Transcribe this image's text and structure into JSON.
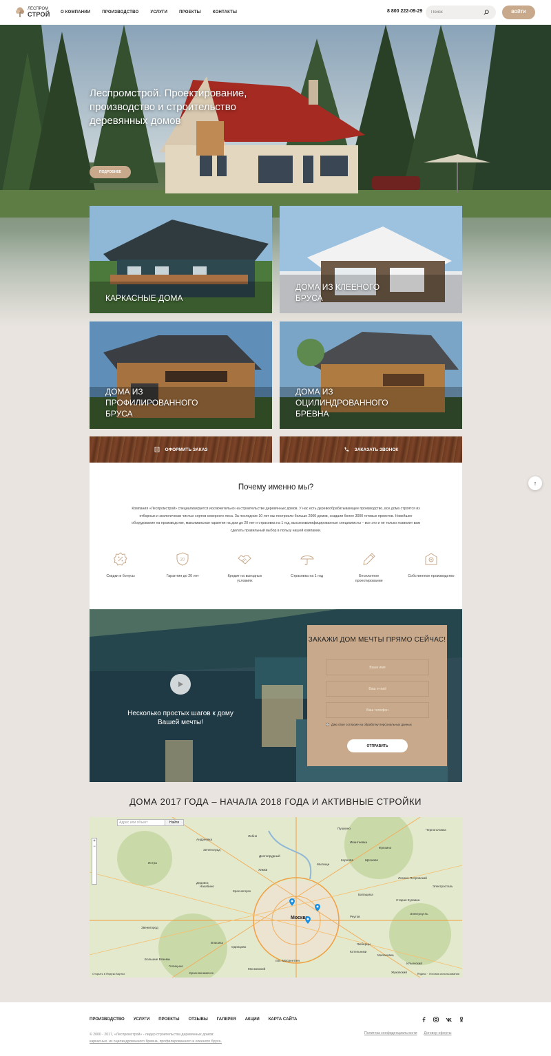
{
  "header": {
    "logo_top": "ЛЕСПРОМ",
    "logo_bottom": "СТРОЙ",
    "nav": [
      "О КОМПАНИИ",
      "ПРОИЗВОДСТВО",
      "УСЛУГИ",
      "ПРОЕКТЫ",
      "КОНТАКТЫ"
    ],
    "phone": "8 800 222-09-29",
    "search_placeholder": "Поиск",
    "login_label": "ВОЙТИ"
  },
  "hero": {
    "title": "Леспромстрой. Проектирование, производство и строительство деревянных домов",
    "button": "ПОДРОБНЕЕ"
  },
  "cards": [
    {
      "title": "КАРКАСНЫЕ ДОМА"
    },
    {
      "title": "ДОМА ИЗ КЛЕЕНОГО БРУСА"
    },
    {
      "title": "ДОМА ИЗ ПРОФИЛИРОВАННОГО БРУСА"
    },
    {
      "title": "ДОМА ИЗ ОЦИЛИНДРОВАННОГО БРЕВНА"
    }
  ],
  "actions": {
    "order": "ОФОРМИТЬ ЗАКАЗ",
    "call": "ЗАКАЗАТЬ ЗВОНОК"
  },
  "why": {
    "title": "Почему именно мы?",
    "text": "Компания «Леспромстрой» специализируется исключительно на строительстве деревянных домов. У нас есть деревообрабатывающее производство, все дома строятся из отборных и экологически чистых сортов северного леса. За последние 10 лет мы построили больше 2000 домов, создали более 3000 готовых проектов. Новейшее оборудование на производстве, максимальная гарантия на дом до 20 лет и страховка на 1 год, высококвалифицированные специалисты – все это и не только позволит вам сделать правильный выбор в пользу нашей компании.",
    "features": [
      {
        "label": "Скидки и бонусы",
        "icon": "discount-icon"
      },
      {
        "label": "Гарантия до 20 лет",
        "icon": "shield-icon"
      },
      {
        "label": "Кредит на выгодных условиях",
        "icon": "handshake-icon"
      },
      {
        "label": "Страховка на 1 год",
        "icon": "umbrella-icon"
      },
      {
        "label": "Бесплатное проектирование",
        "icon": "pencil-icon"
      },
      {
        "label": "Собственное производство",
        "icon": "factory-icon"
      }
    ]
  },
  "video": {
    "caption": "Несколько простых шагов к дому Вашей мечты!"
  },
  "form": {
    "title": "ЗАКАЖИ ДОМ МЕЧТЫ ПРЯМО СЕЙЧАС!",
    "name_placeholder": "Ваше имя",
    "email_placeholder": "Ваш e-mail",
    "phone_placeholder": "Ваш телефон",
    "agree": "Даю свое согласие на обработку персональных данных",
    "submit": "ОТПРАВИТЬ"
  },
  "map": {
    "title": "ДОМА 2017 ГОДА – НАЧАЛА 2018 ГОДА И АКТИВНЫЕ СТРОЙКИ",
    "search_placeholder": "Адрес или объект",
    "find_button": "Найти",
    "city": "Москва",
    "labels": [
      "Андреевка",
      "Зеленоград",
      "Лобня",
      "Долгопрудный",
      "Пушкино",
      "Ивантеевка",
      "Фрязино",
      "Королёв",
      "Щёлково",
      "Мытищи",
      "Истра",
      "Химки",
      "Красногорск",
      "Балашиха",
      "Лосино-Петровский",
      "Старая Купавна",
      "Электроугль",
      "Реутов",
      "Люберцы",
      "Котельники",
      "Звенигород",
      "Одинцово",
      "Власиха",
      "Малаховка",
      "Ильинский",
      "Жуковский",
      "Большие Вяземы",
      "Голицыно",
      "Московский",
      "пос. Мосрентген",
      "Краснознаменск",
      "Дедовск",
      "Нахабино",
      "Черноголовка",
      "Электросталь"
    ],
    "open_link": "Открыть в Яндекс.Картах",
    "copyright": "Яндекс · Условия использования"
  },
  "footer": {
    "nav": [
      "ПРОИЗВОДСТВО",
      "УСЛУГИ",
      "ПРОЕКТЫ",
      "ОТЗЫВЫ",
      "ГАЛЕРЕЯ",
      "АКЦИИ",
      "КАРТА САЙТА"
    ],
    "socials": [
      "f",
      "ig",
      "vk",
      "ok"
    ],
    "copyright_line1": "© 2000 - 2017, «Леспромстрой» - лидер строительства деревянных домов:",
    "copyright_line2": "каркасных, из оцилиндрованного бревна, профилированного и клееного бруса.",
    "privacy": "Политика конфиденциальности",
    "offer": "Договор оферты"
  },
  "colors": {
    "accent": "#c8a98b",
    "wood": "#6b3a22",
    "background": "#e9e4df"
  }
}
